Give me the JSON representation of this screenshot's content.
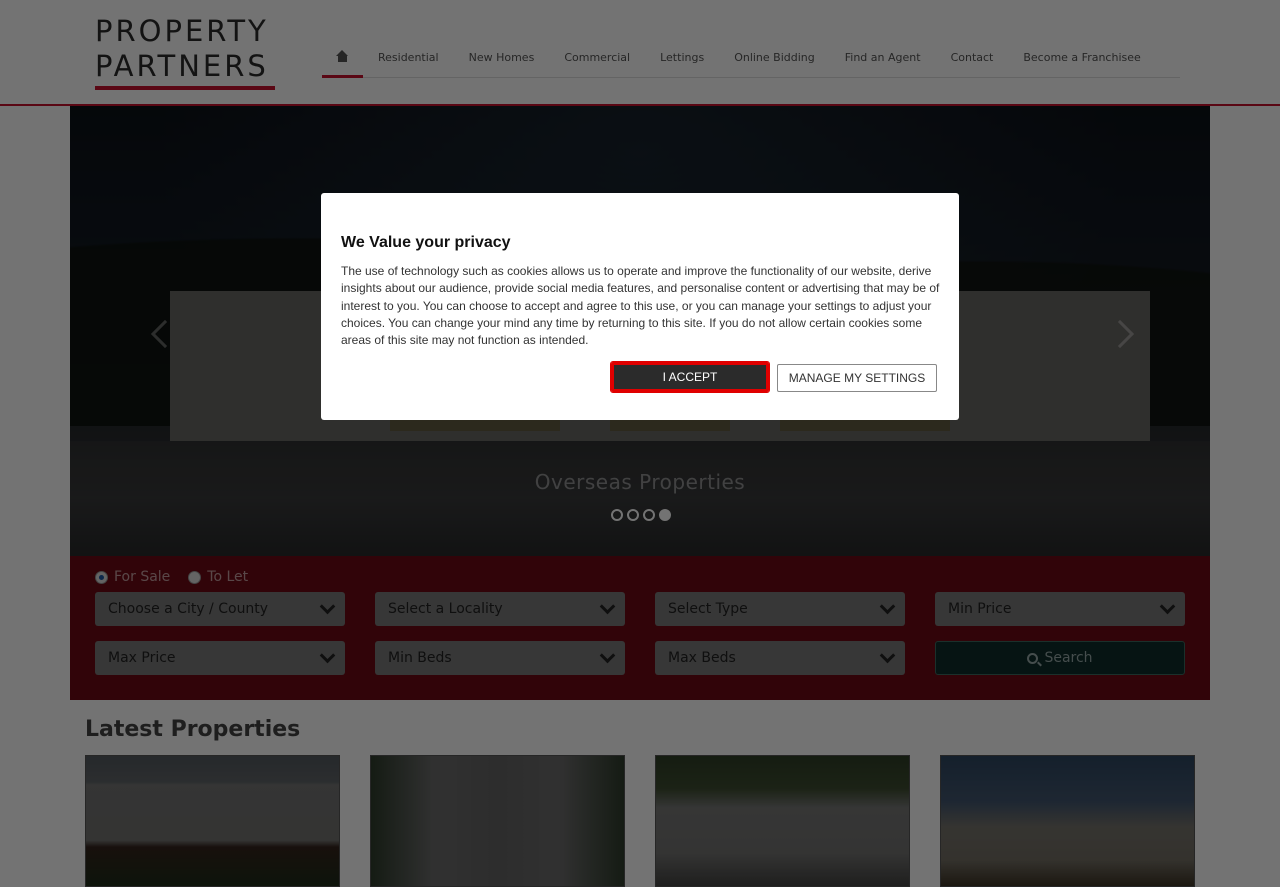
{
  "brand": {
    "line1": "PROPERTY",
    "line2": "PARTNERS",
    "accent": "#c8102e"
  },
  "nav": {
    "home_icon": "home-icon",
    "items": [
      "Residential",
      "New Homes",
      "Commercial",
      "Lettings",
      "Online Bidding",
      "Find an Agent",
      "Contact",
      "Become a Franchisee"
    ]
  },
  "hero": {
    "caption": "Overseas Properties",
    "slides_count": 4,
    "active_slide": 4
  },
  "search": {
    "mode_options": [
      "For Sale",
      "To Let"
    ],
    "mode_selected": "For Sale",
    "city": "Choose a City / County",
    "locality": "Select a Locality",
    "type": "Select Type",
    "min_price": "Min Price",
    "max_price": "Max Price",
    "min_beds": "Min Beds",
    "max_beds": "Max Beds",
    "button": "Search"
  },
  "latest": {
    "title": "Latest Properties"
  },
  "modal": {
    "title": "We Value your privacy",
    "body": "The use of technology such as cookies allows us to operate and improve the functionality of our website, derive insights about our audience, provide social media features, and personalise content or advertising that may be of interest to you. You can choose to accept and agree to this use, or you can manage your settings to adjust your choices. You can change your mind any time by returning to this site. If you do not allow certain cookies some areas of this site may not function as intended.",
    "accept": "I ACCEPT",
    "manage": "MANAGE MY SETTINGS"
  }
}
